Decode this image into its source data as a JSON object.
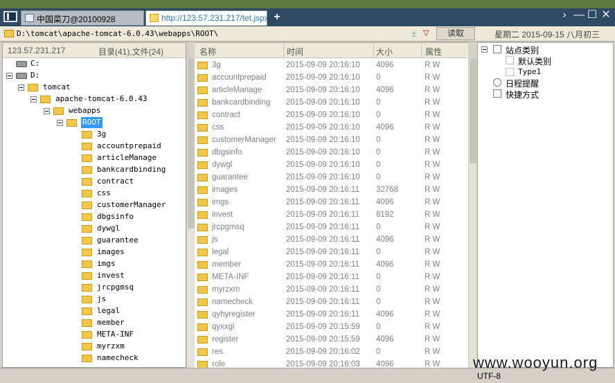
{
  "tabs": [
    {
      "label": "中国菜刀@20100928"
    },
    {
      "label": "http://123.57.231.217/tet.jspx"
    }
  ],
  "new_tab_label": "+",
  "window_controls": {
    "chevron": "›",
    "minimize": "—",
    "maximize": "☐",
    "close": "✕"
  },
  "address": {
    "path": "D:\\tomcat\\apache-tomcat-6.0.43\\webapps\\ROOT\\",
    "star": "±",
    "dropdown": "▽",
    "read_label": "读取",
    "date": "星期二 2015-09-15 八月初三"
  },
  "left": {
    "ip": "123.57.231.217",
    "summary": "目录(41),文件(24)",
    "tree": [
      {
        "label": "C:"
      },
      {
        "label": "D:"
      },
      {
        "label": "tomcat"
      },
      {
        "label": "apache-tomcat-6.0.43"
      },
      {
        "label": "webapps"
      },
      {
        "label": "ROOT"
      },
      {
        "label": "3g"
      },
      {
        "label": "accountprepaid"
      },
      {
        "label": "articleManage"
      },
      {
        "label": "bankcardbinding"
      },
      {
        "label": "contract"
      },
      {
        "label": "css"
      },
      {
        "label": "customerManager"
      },
      {
        "label": "dbgsinfo"
      },
      {
        "label": "dywgl"
      },
      {
        "label": "guarantee"
      },
      {
        "label": "images"
      },
      {
        "label": "imgs"
      },
      {
        "label": "invest"
      },
      {
        "label": "jrcpgmsq"
      },
      {
        "label": "js"
      },
      {
        "label": "legal"
      },
      {
        "label": "member"
      },
      {
        "label": "META-INF"
      },
      {
        "label": "myrzxm"
      },
      {
        "label": "namecheck"
      }
    ]
  },
  "files": {
    "columns": {
      "name": "名称",
      "time": "时间",
      "size": "大小",
      "attr": "属性"
    },
    "rows": [
      {
        "name": "3g",
        "time": "2015-09-09 20:16:10",
        "size": "4096",
        "attr": "R W"
      },
      {
        "name": "accountprepaid",
        "time": "2015-09-09 20:16:10",
        "size": "0",
        "attr": "R W"
      },
      {
        "name": "articleManage",
        "time": "2015-09-09 20:16:10",
        "size": "4096",
        "attr": "R W"
      },
      {
        "name": "bankcardbinding",
        "time": "2015-09-09 20:16:10",
        "size": "0",
        "attr": "R W"
      },
      {
        "name": "contract",
        "time": "2015-09-09 20:16:10",
        "size": "0",
        "attr": "R W"
      },
      {
        "name": "css",
        "time": "2015-09-09 20:16:10",
        "size": "4096",
        "attr": "R W"
      },
      {
        "name": "customerManager",
        "time": "2015-09-09 20:16:10",
        "size": "0",
        "attr": "R W"
      },
      {
        "name": "dbgsinfo",
        "time": "2015-09-09 20:16:10",
        "size": "0",
        "attr": "R W"
      },
      {
        "name": "dywgl",
        "time": "2015-09-09 20:16:10",
        "size": "0",
        "attr": "R W"
      },
      {
        "name": "guarantee",
        "time": "2015-09-09 20:16:10",
        "size": "0",
        "attr": "R W"
      },
      {
        "name": "images",
        "time": "2015-09-09 20:16:11",
        "size": "32768",
        "attr": "R W"
      },
      {
        "name": "imgs",
        "time": "2015-09-09 20:16:11",
        "size": "4096",
        "attr": "R W"
      },
      {
        "name": "invest",
        "time": "2015-09-09 20:16:11",
        "size": "8192",
        "attr": "R W"
      },
      {
        "name": "jrcpgmsq",
        "time": "2015-09-09 20:16:11",
        "size": "0",
        "attr": "R W"
      },
      {
        "name": "js",
        "time": "2015-09-09 20:16:11",
        "size": "4096",
        "attr": "R W"
      },
      {
        "name": "legal",
        "time": "2015-09-09 20:16:11",
        "size": "0",
        "attr": "R W"
      },
      {
        "name": "member",
        "time": "2015-09-09 20:16:11",
        "size": "4096",
        "attr": "R W"
      },
      {
        "name": "META-INF",
        "time": "2015-09-09 20:16:11",
        "size": "0",
        "attr": "R W"
      },
      {
        "name": "myrzxm",
        "time": "2015-09-09 20:16:11",
        "size": "0",
        "attr": "R W"
      },
      {
        "name": "namecheck",
        "time": "2015-09-09 20:16:11",
        "size": "0",
        "attr": "R W"
      },
      {
        "name": "qyhyregister",
        "time": "2015-09-09 20:16:11",
        "size": "4096",
        "attr": "R W"
      },
      {
        "name": "qyxxgl",
        "time": "2015-09-09 20:15:59",
        "size": "0",
        "attr": "R W"
      },
      {
        "name": "register",
        "time": "2015-09-09 20:15:59",
        "size": "4096",
        "attr": "R W"
      },
      {
        "name": "res",
        "time": "2015-09-09 20:16:02",
        "size": "0",
        "attr": "R W"
      },
      {
        "name": "role",
        "time": "2015-09-09 20:16:03",
        "size": "4096",
        "attr": "R W"
      }
    ]
  },
  "categories": {
    "site": "站点类别",
    "default": "默认类别",
    "type1": "Type1",
    "schedule": "日程提醒",
    "shortcut": "快捷方式"
  },
  "status": {
    "encoding": "UTF-8"
  },
  "watermark": "www.wooyun.org"
}
